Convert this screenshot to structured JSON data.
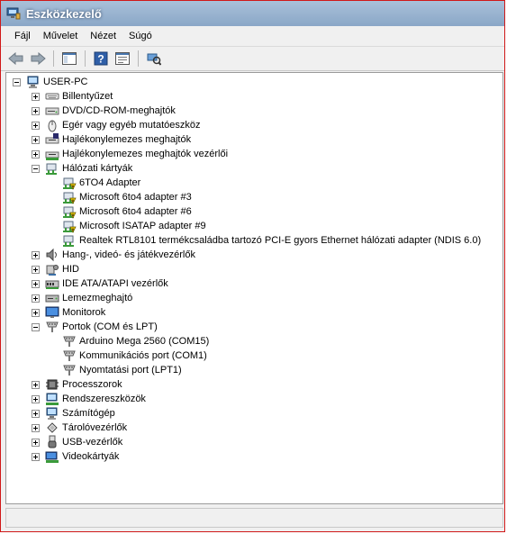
{
  "window": {
    "title": "Eszközkezelő"
  },
  "menu": [
    "Fájl",
    "Művelet",
    "Nézet",
    "Súgó"
  ],
  "toolbar": {
    "buttons": [
      "back-icon",
      "forward-icon",
      "show-hide-tree-icon",
      "help-icon",
      "properties-icon",
      "scan-hardware-icon"
    ]
  },
  "tree": {
    "root": "USER-PC",
    "categories": [
      {
        "label": "Billentyűzet",
        "icon": "keyboard-icon",
        "expanded": false
      },
      {
        "label": "DVD/CD-ROM-meghajtók",
        "icon": "dvd-drive-icon",
        "expanded": false
      },
      {
        "label": "Egér vagy egyéb mutatóeszköz",
        "icon": "mouse-icon",
        "expanded": false
      },
      {
        "label": "Hajlékonylemezes meghajtók",
        "icon": "floppy-drive-icon",
        "expanded": false
      },
      {
        "label": "Hajlékonylemezes meghajtók vezérlői",
        "icon": "floppy-controller-icon",
        "expanded": false
      },
      {
        "label": "Hálózati kártyák",
        "icon": "network-adapter-icon",
        "expanded": true,
        "children": [
          {
            "label": "6TO4 Adapter",
            "icon": "network-adapter-warning-icon"
          },
          {
            "label": "Microsoft 6to4 adapter #3",
            "icon": "network-adapter-warning-icon"
          },
          {
            "label": "Microsoft 6to4 adapter #6",
            "icon": "network-adapter-warning-icon"
          },
          {
            "label": "Microsoft ISATAP adapter #9",
            "icon": "network-adapter-warning-icon"
          },
          {
            "label": "Realtek RTL8101 termékcsaládba tartozó PCI-E gyors Ethernet hálózati adapter (NDIS 6.0)",
            "icon": "network-adapter-icon"
          }
        ]
      },
      {
        "label": "Hang-, videó- és játékvezérlők",
        "icon": "sound-icon",
        "expanded": false
      },
      {
        "label": "HID",
        "icon": "hid-icon",
        "expanded": false
      },
      {
        "label": "IDE ATA/ATAPI vezérlők",
        "icon": "ide-controller-icon",
        "expanded": false
      },
      {
        "label": "Lemezmeghajtó",
        "icon": "disk-drive-icon",
        "expanded": false
      },
      {
        "label": "Monitorok",
        "icon": "monitor-icon",
        "expanded": false
      },
      {
        "label": "Portok (COM és LPT)",
        "icon": "port-icon",
        "expanded": true,
        "children": [
          {
            "label": "Arduino Mega 2560 (COM15)",
            "icon": "port-icon"
          },
          {
            "label": "Kommunikációs port (COM1)",
            "icon": "port-icon"
          },
          {
            "label": "Nyomtatási port (LPT1)",
            "icon": "port-icon"
          }
        ]
      },
      {
        "label": "Processzorok",
        "icon": "processor-icon",
        "expanded": false
      },
      {
        "label": "Rendszereszközök",
        "icon": "system-devices-icon",
        "expanded": false
      },
      {
        "label": "Számítógép",
        "icon": "computer-icon",
        "expanded": false
      },
      {
        "label": "Tárolóvezérlők",
        "icon": "storage-controller-icon",
        "expanded": false
      },
      {
        "label": "USB-vezérlők",
        "icon": "usb-icon",
        "expanded": false
      },
      {
        "label": "Videokártyák",
        "icon": "display-adapter-icon",
        "expanded": false
      }
    ]
  },
  "colors": {
    "window_border": "#d01818",
    "titlebar": "#8aa7c7",
    "warning": "#f5d000"
  }
}
